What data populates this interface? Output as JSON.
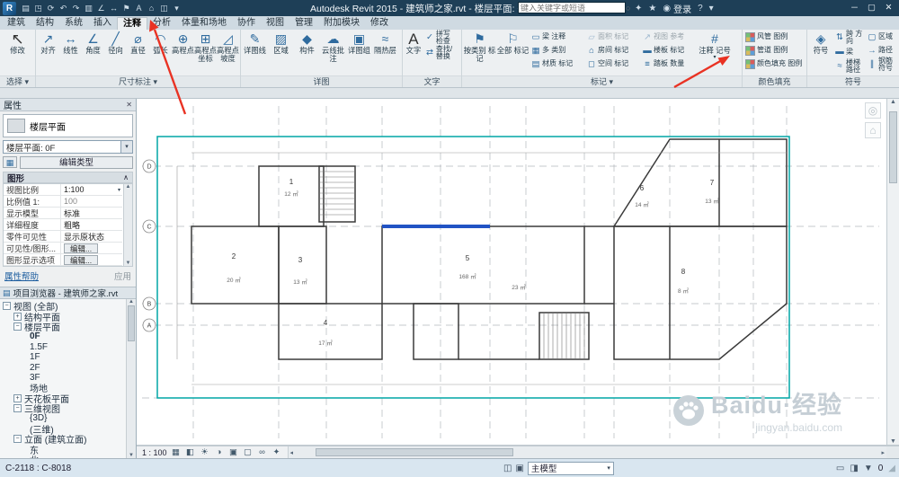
{
  "glyphs": {
    "close": "✕",
    "caret": "▾",
    "up": "▲",
    "down": "▼",
    "left": "◂",
    "right": "▸",
    "grip": "◢",
    "collapse": "∧",
    "search": "○"
  },
  "titlebar": {
    "logo": "R",
    "qat": [
      "▤",
      "◳",
      "⟳",
      "↶",
      "↷",
      "▥",
      "∠",
      "↔",
      "⚑",
      "A",
      "⌂",
      "◫",
      "▾"
    ],
    "title": "Autodesk Revit 2015 - 建筑师之家.rvt - 楼层平面: 0F",
    "search_placeholder": "键入关键字或短语",
    "right_icons": [
      "✦",
      "★",
      "◉"
    ],
    "signin": "登录",
    "help": "?",
    "window": {
      "min": "─",
      "max": "▢",
      "close": "✕"
    }
  },
  "ribbon": {
    "tabs": [
      "建筑",
      "结构",
      "系统",
      "插入",
      "注释",
      "分析",
      "体量和场地",
      "协作",
      "视图",
      "管理",
      "附加模块",
      "修改"
    ],
    "panels": [
      {
        "label": "选择 ▾",
        "tools": [
          {
            "label": "修改",
            "icon": "↖"
          }
        ]
      },
      {
        "label": "尺寸标注 ▾",
        "tools": [
          {
            "label": "对齐",
            "icon": "↗"
          },
          {
            "label": "线性",
            "icon": "↔"
          },
          {
            "label": "角度",
            "icon": "∠"
          },
          {
            "label": "径向",
            "icon": "╱"
          },
          {
            "label": "直径",
            "icon": "⌀"
          },
          {
            "label": "弧长",
            "icon": "◠"
          },
          {
            "label": "高程点",
            "icon": "⊕"
          },
          {
            "label": "高程点 坐标",
            "icon": "⊞"
          },
          {
            "label": "高程点 坡度",
            "icon": "◿"
          }
        ]
      },
      {
        "label": "详图",
        "tools": [
          {
            "label": "详图线",
            "icon": "✎"
          },
          {
            "label": "区域",
            "icon": "▨"
          },
          {
            "label": "构件",
            "icon": "◆"
          },
          {
            "label": "云线批注",
            "icon": "☁"
          },
          {
            "label": "详图组",
            "icon": "▣"
          },
          {
            "label": "隔热层",
            "icon": "≈"
          }
        ]
      },
      {
        "label": "文字",
        "tools": [
          {
            "label": "文字",
            "icon": "A"
          },
          {
            "label": "拼写 检查",
            "icon": "✓"
          },
          {
            "label": "查找/ 替换",
            "icon": "⇄"
          }
        ]
      },
      {
        "label": "标记 ▾",
        "tools": [
          {
            "label": "按类别 标记",
            "icon": "⚑"
          },
          {
            "label": "全部 标记",
            "icon": "⚐"
          },
          {
            "label": "梁 注释",
            "icon": "▭"
          },
          {
            "label": "多 类别",
            "icon": "▦"
          },
          {
            "label": "材质 标记",
            "icon": "▤"
          },
          {
            "label": "面积 标记",
            "icon": "▱"
          },
          {
            "label": "房间 标记",
            "icon": "⌂"
          },
          {
            "label": "空间 标记",
            "icon": "◻"
          },
          {
            "label": "视图 参考",
            "icon": "↗"
          },
          {
            "label": "楼板 标记",
            "icon": "▬"
          },
          {
            "label": "踏板 数量",
            "icon": "≡"
          },
          {
            "label": "注释 记号",
            "icon": "#"
          }
        ]
      },
      {
        "label": "颜色填充",
        "tools": [
          {
            "label": "风管 图例"
          },
          {
            "label": "管道 图例"
          },
          {
            "label": "颜色填充 图例"
          }
        ]
      },
      {
        "label": "符号",
        "tools": [
          {
            "label": "符号",
            "icon": "◈"
          },
          {
            "label": "跨 方向",
            "icon": "⇅"
          },
          {
            "label": "区域",
            "icon": "▢"
          },
          {
            "label": "梁",
            "icon": "▬"
          },
          {
            "label": "路径",
            "icon": "→"
          },
          {
            "label": "楼梯 路径",
            "icon": "≈"
          },
          {
            "label": "钢筋 符号",
            "icon": "∥"
          }
        ]
      }
    ]
  },
  "properties": {
    "title": "属性",
    "type_label": "楼层平面",
    "selector": "楼层平面: 0F",
    "edit_type": "编辑类型",
    "section": "图形",
    "rows": [
      {
        "label": "视图比例",
        "value": "1:100"
      },
      {
        "label": "比例值 1:",
        "value": "100"
      },
      {
        "label": "显示模型",
        "value": "标准"
      },
      {
        "label": "详细程度",
        "value": "粗略"
      },
      {
        "label": "零件可见性",
        "value": "显示原状态"
      },
      {
        "label": "可见性/图形...",
        "value": "编辑..."
      },
      {
        "label": "图形显示选项",
        "value": "编辑..."
      }
    ],
    "help": "属性帮助",
    "apply": "应用"
  },
  "browser": {
    "title": "项目浏览器 - 建筑师之家.rvt",
    "items": [
      {
        "t": "视图 (全部)",
        "e": "−"
      },
      {
        "t": "结构平面",
        "e": "+"
      },
      {
        "t": "楼层平面",
        "e": "−"
      },
      {
        "t": "0F"
      },
      {
        "t": "1.5F"
      },
      {
        "t": "1F"
      },
      {
        "t": "2F"
      },
      {
        "t": "3F"
      },
      {
        "t": "场地"
      },
      {
        "t": "天花板平面",
        "e": "+"
      },
      {
        "t": "三维视图",
        "e": "−"
      },
      {
        "t": "{3D}"
      },
      {
        "t": "(三维)"
      },
      {
        "t": "立面 (建筑立面)",
        "e": "−"
      },
      {
        "t": "东"
      },
      {
        "t": "北"
      }
    ]
  },
  "plan": {
    "grids": [
      "D",
      "C",
      "B",
      "A"
    ],
    "rooms": [
      {
        "num": "1",
        "area": "12 ㎡"
      },
      {
        "num": "2",
        "area": "20 ㎡"
      },
      {
        "num": "3",
        "area": "13 ㎡"
      },
      {
        "num": "4",
        "area": "17 ㎡"
      },
      {
        "num": "5",
        "area": "168 ㎡"
      },
      {
        "num": "",
        "area": "23 ㎡"
      },
      {
        "num": "6",
        "area": "14 ㎡"
      },
      {
        "num": "7",
        "area": "13 ㎡"
      },
      {
        "num": "8",
        "area": "8 ㎡"
      }
    ]
  },
  "viewbar": {
    "scale": "1 : 100",
    "icons": [
      "▦",
      "◧",
      "☀",
      "◑",
      "▣",
      "▢",
      "∞",
      "✦"
    ]
  },
  "statusbar": {
    "selection": "C-2118 : C-8018",
    "icons": [
      "◫",
      "▣"
    ],
    "workset": "主模型",
    "right_icons": [
      "▭",
      "◨",
      "▼"
    ],
    "filter_count": "0"
  },
  "watermark": {
    "brand": "Baidu·经验",
    "site": "jingyan.baidu.com"
  }
}
